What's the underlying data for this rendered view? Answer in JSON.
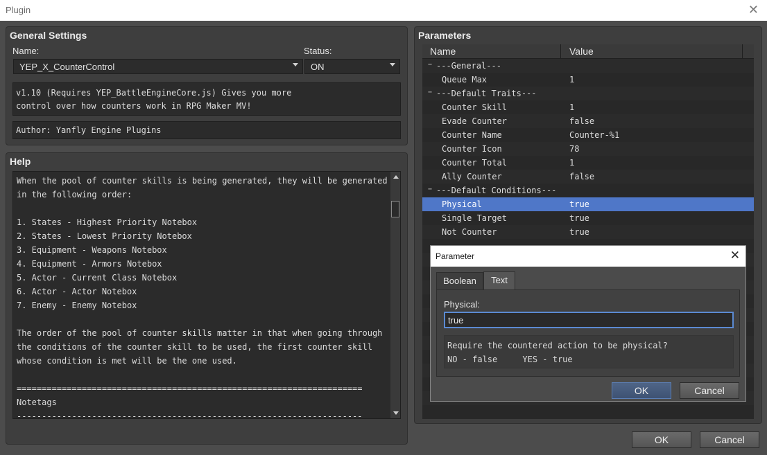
{
  "window": {
    "title": "Plugin"
  },
  "general": {
    "section_title": "General Settings",
    "name_label": "Name:",
    "name_value": "YEP_X_CounterControl",
    "status_label": "Status:",
    "status_value": "ON",
    "description": "v1.10 (Requires YEP_BattleEngineCore.js) Gives you more\ncontrol over how counters work in RPG Maker MV!",
    "author": "Author: Yanfly Engine Plugins"
  },
  "help": {
    "section_title": "Help",
    "text": "When the pool of counter skills is being generated, they will be generated\nin the following order:\n\n1. States - Highest Priority Notebox\n2. States - Lowest Priority Notebox\n3. Equipment - Weapons Notebox\n4. Equipment - Armors Notebox\n5. Actor - Current Class Notebox\n6. Actor - Actor Notebox\n7. Enemy - Enemy Notebox\n\nThe order of the pool of counter skills matter in that when going through\nthe conditions of the counter skill to be used, the first counter skill\nwhose condition is met will be the one used.\n\n=====================================================================\nNotetags\n---------------------------------------------------------------------"
  },
  "parameters": {
    "section_title": "Parameters",
    "columns": {
      "name": "Name",
      "value": "Value"
    },
    "rows": [
      {
        "name": "---General---",
        "value": "",
        "group": true
      },
      {
        "name": "Queue Max",
        "value": "1"
      },
      {
        "name": "---Default Traits---",
        "value": "",
        "group": true
      },
      {
        "name": "Counter Skill",
        "value": "1"
      },
      {
        "name": "Evade Counter",
        "value": "false"
      },
      {
        "name": "Counter Name",
        "value": "Counter-%1"
      },
      {
        "name": "Counter Icon",
        "value": "78"
      },
      {
        "name": "Counter Total",
        "value": "1"
      },
      {
        "name": "Ally Counter",
        "value": "false"
      },
      {
        "name": "---Default Conditions---",
        "value": "",
        "group": true
      },
      {
        "name": "Physical",
        "value": "true",
        "selected": true
      },
      {
        "name": "Single Target",
        "value": "true"
      },
      {
        "name": "Not Counter",
        "value": "true"
      }
    ]
  },
  "dialog": {
    "title": "Parameter",
    "tabs": [
      "Boolean",
      "Text"
    ],
    "active_tab": "Text",
    "field_label": "Physical:",
    "field_value": "true",
    "note": "Require the countered action to be physical?\nNO - false     YES - true",
    "ok_label": "OK",
    "cancel_label": "Cancel"
  },
  "footer": {
    "ok_label": "OK",
    "cancel_label": "Cancel"
  },
  "colors": {
    "selection": "#4f77c8",
    "focus_border": "#5b8ad2"
  }
}
